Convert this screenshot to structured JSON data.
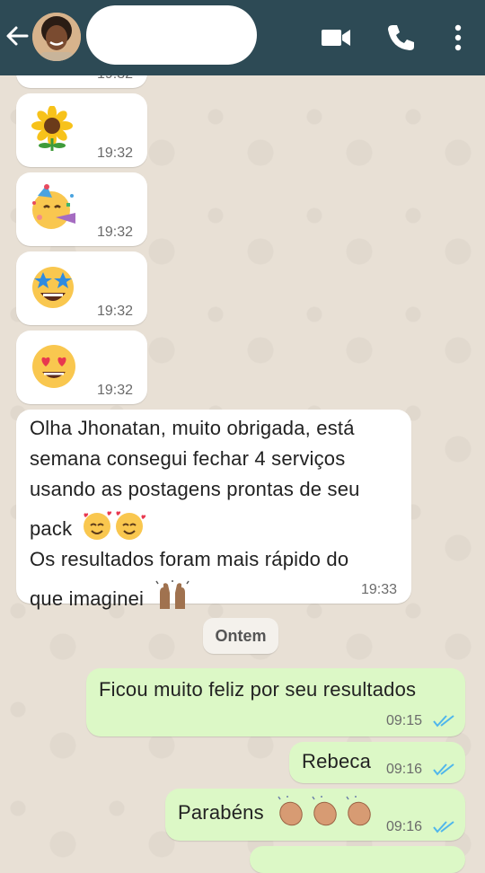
{
  "header": {
    "back_icon": "back-arrow-icon",
    "video_icon": "video-call-icon",
    "call_icon": "phone-icon",
    "menu_icon": "more-vertical-icon",
    "color": "#2d4a55"
  },
  "messages": [
    {
      "type": "emoji",
      "emoji": "sunflower",
      "time": "19:32"
    },
    {
      "type": "emoji",
      "emoji": "partying-face",
      "time": "19:32"
    },
    {
      "type": "emoji",
      "emoji": "star-struck",
      "time": "19:32"
    },
    {
      "type": "emoji",
      "emoji": "heart-eyes",
      "time": "19:32"
    },
    {
      "type": "text",
      "lines": [
        "Olha Jhonatan, muito obrigada, está",
        "semana consegui fechar 4 serviços",
        "usando as postagens prontas de seu",
        "pack",
        "Os resultados foram mais rápido do",
        "que imaginei"
      ],
      "time": "19:33"
    }
  ],
  "top_partial_time": "19:32",
  "date_chip": "Ontem",
  "sent": [
    {
      "text": "Ficou muito feliz por seu resultados",
      "time": "09:15"
    },
    {
      "text": "Rebeca",
      "time": "09:16"
    },
    {
      "text": "Parabéns",
      "time": "09:16"
    }
  ],
  "colors": {
    "incoming": "#ffffff",
    "outgoing": "#dcf8c6",
    "read_ticks": "#4fb6ec",
    "background": "#e8e0d5"
  }
}
